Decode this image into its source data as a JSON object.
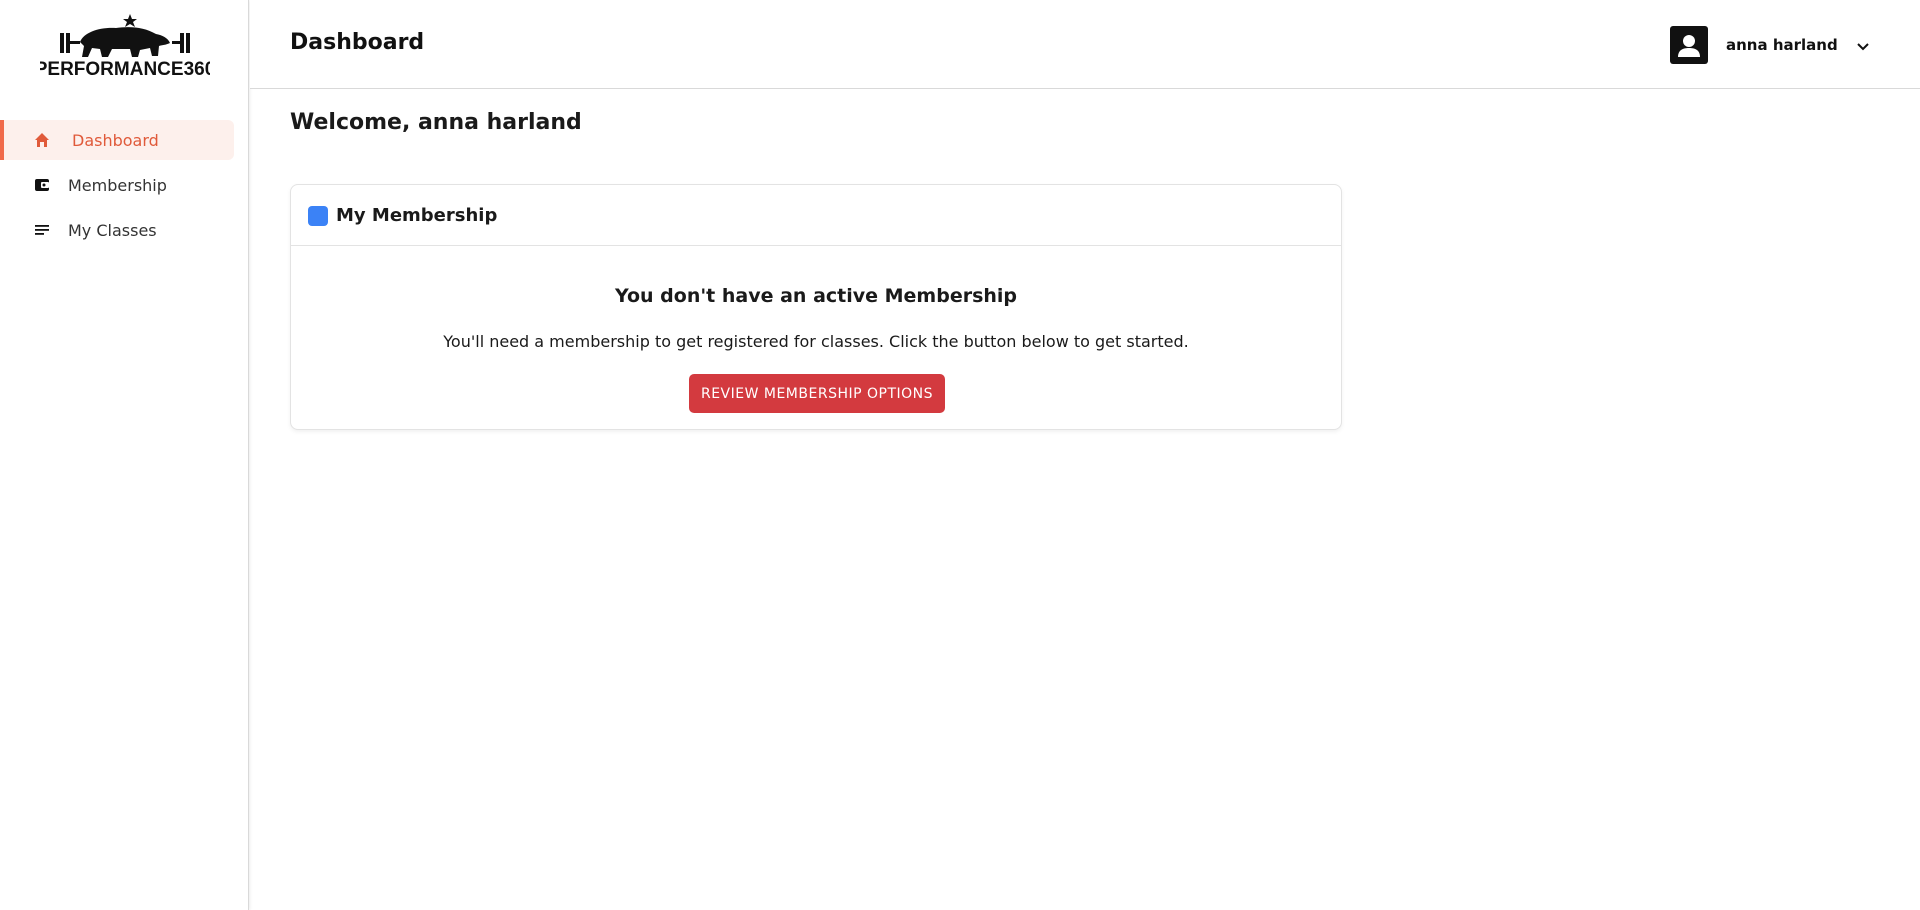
{
  "brand": {
    "logo_text": "PERFORMANCE360"
  },
  "sidebar": {
    "items": [
      {
        "label": "Dashboard",
        "icon": "home-icon",
        "active": true
      },
      {
        "label": "Membership",
        "icon": "wallet-icon",
        "active": false
      },
      {
        "label": "My Classes",
        "icon": "list-icon",
        "active": false
      }
    ]
  },
  "header": {
    "title": "Dashboard",
    "user_name": "anna harland"
  },
  "main": {
    "welcome": "Welcome, anna harland",
    "membership_card": {
      "title": "My Membership",
      "empty_title": "You don't have an active Membership",
      "empty_text": "You'll need a membership to get registered for classes. Click the button below to get started.",
      "button_label": "REVIEW MEMBERSHIP OPTIONS"
    }
  },
  "colors": {
    "accent": "#f06a4a",
    "active_bg": "#fdf0ec",
    "cta": "#d33a3f",
    "badge": "#3b82f6"
  }
}
